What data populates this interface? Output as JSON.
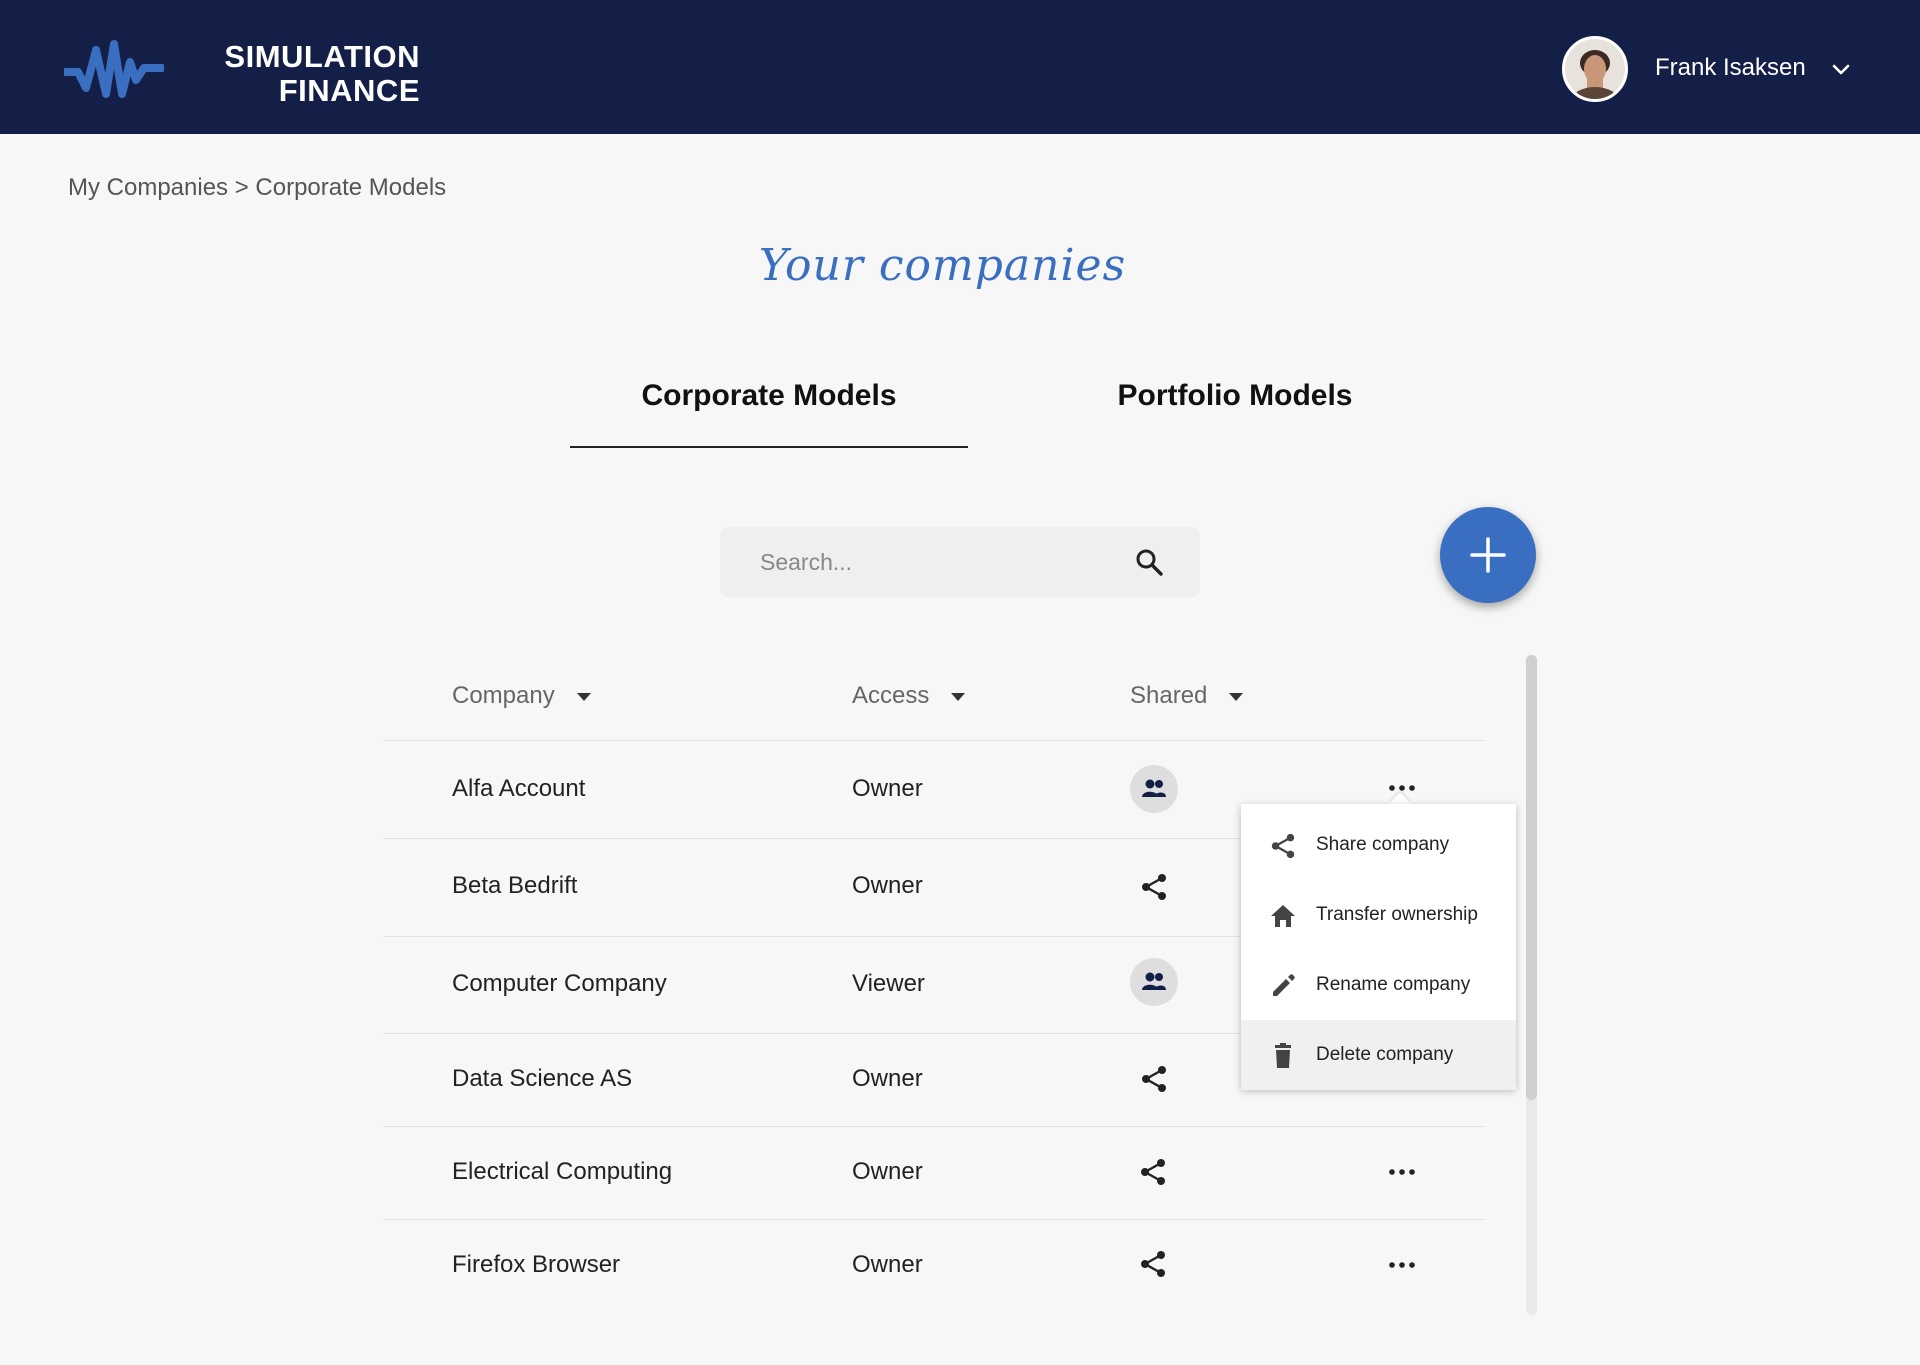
{
  "header": {
    "logo_line1": "SIMULATION",
    "logo_line2": "FINANCE",
    "user_name": "Frank Isaksen"
  },
  "breadcrumb": "My Companies > Corporate Models",
  "page_title": "Your companies",
  "tabs": [
    {
      "label": "Corporate Models",
      "active": true
    },
    {
      "label": "Portfolio Models",
      "active": false
    }
  ],
  "search": {
    "placeholder": "Search...",
    "value": ""
  },
  "table": {
    "columns": [
      "Company",
      "Access",
      "Shared"
    ],
    "rows": [
      {
        "company": "Alfa Account",
        "access": "Owner",
        "shared": "people-icon"
      },
      {
        "company": "Beta Bedrift",
        "access": "Owner",
        "shared": "share-icon"
      },
      {
        "company": "Computer Company",
        "access": "Viewer",
        "shared": "people-icon"
      },
      {
        "company": "Data Science AS",
        "access": "Owner",
        "shared": "share-icon"
      },
      {
        "company": "Electrical Computing",
        "access": "Owner",
        "shared": "share-icon"
      },
      {
        "company": "Firefox Browser",
        "access": "Owner",
        "shared": "share-icon"
      }
    ]
  },
  "context_menu": {
    "items": [
      {
        "label": "Share company",
        "icon": "share-icon"
      },
      {
        "label": "Transfer ownership",
        "icon": "home-icon"
      },
      {
        "label": "Rename company",
        "icon": "pencil-icon"
      },
      {
        "label": "Delete company",
        "icon": "trash-icon"
      }
    ]
  },
  "colors": {
    "header_bg": "#141f48",
    "accent": "#3a6ec0",
    "page_bg": "#f7f7f7"
  }
}
